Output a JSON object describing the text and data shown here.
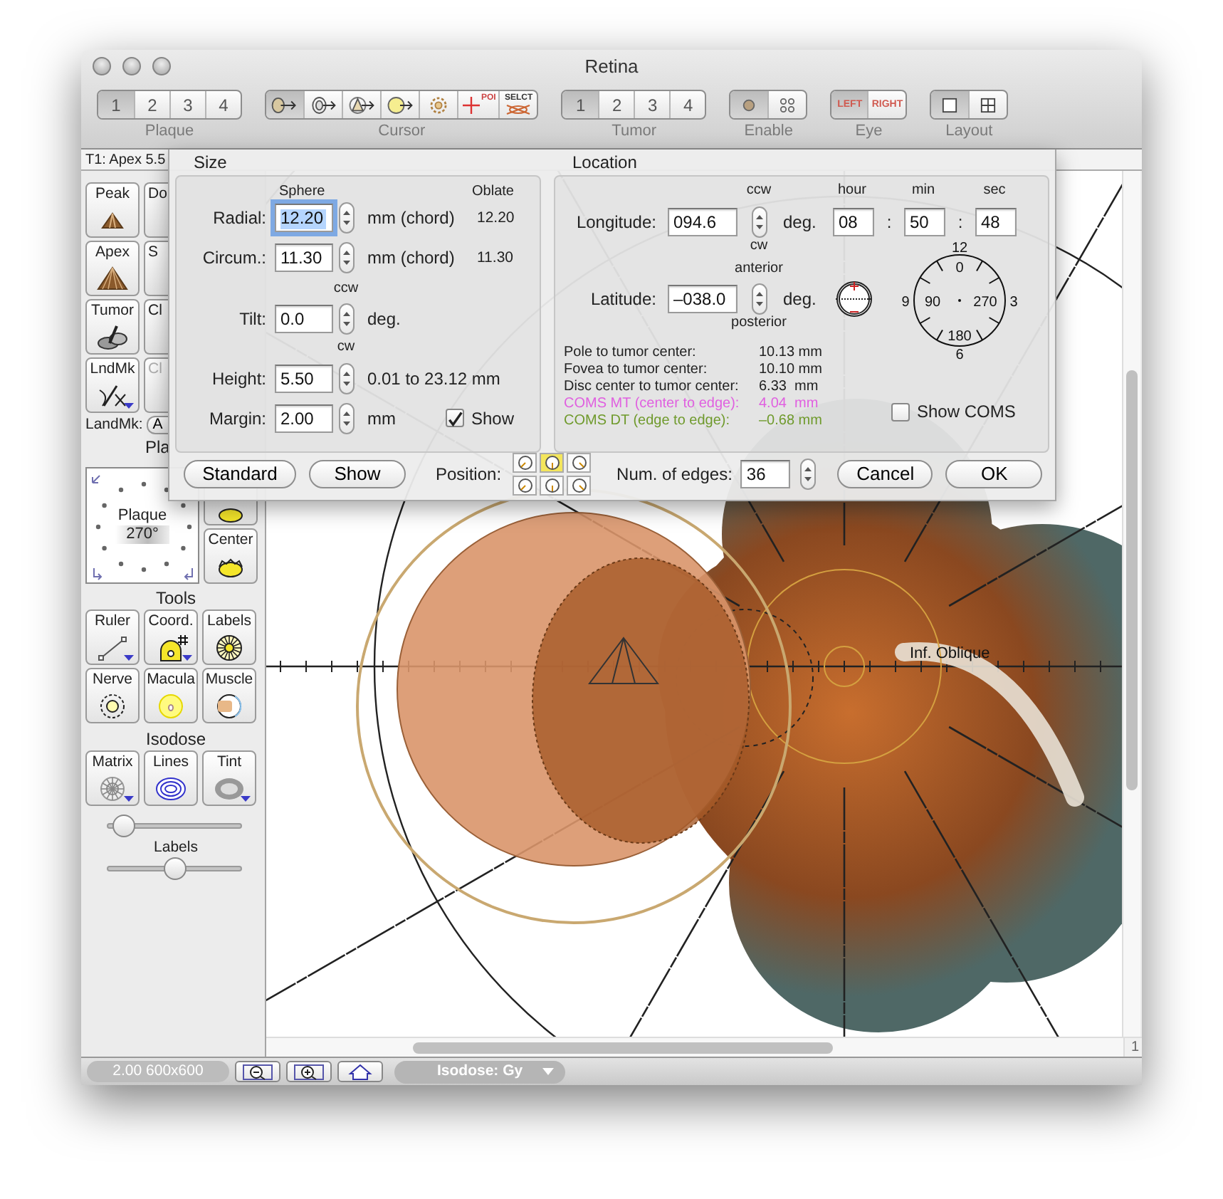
{
  "window": {
    "title": "Retina"
  },
  "toolbar": [
    {
      "label": "Plaque",
      "items": [
        {
          "kind": "number",
          "text": "1",
          "selected": true
        },
        {
          "kind": "number",
          "text": "2",
          "selected": false
        },
        {
          "kind": "number",
          "text": "3",
          "selected": false
        },
        {
          "kind": "number",
          "text": "4",
          "selected": false
        }
      ]
    },
    {
      "label": "Cursor",
      "items": [
        {
          "kind": "oval-arrow",
          "selected": true
        },
        {
          "kind": "ring-arrow",
          "selected": false
        },
        {
          "kind": "triangle-arrow",
          "selected": false
        },
        {
          "kind": "circle-arrow",
          "selected": false
        },
        {
          "kind": "gear",
          "selected": false
        },
        {
          "kind": "poi",
          "text": "POI",
          "selected": false
        },
        {
          "kind": "select",
          "text": "SELCT",
          "selected": false
        }
      ]
    },
    {
      "label": "Tumor",
      "items": [
        {
          "kind": "number",
          "text": "1",
          "selected": true
        },
        {
          "kind": "number",
          "text": "2",
          "selected": false
        },
        {
          "kind": "number",
          "text": "3",
          "selected": false
        },
        {
          "kind": "number",
          "text": "4",
          "selected": false
        }
      ]
    },
    {
      "label": "Enable",
      "items": [
        {
          "kind": "dot",
          "selected": true
        },
        {
          "kind": "dots",
          "selected": false
        }
      ]
    },
    {
      "label": "Eye",
      "items": [
        {
          "kind": "eye",
          "text": "LEFT",
          "selected": true
        },
        {
          "kind": "eye",
          "text": "RIGHT",
          "selected": false
        }
      ]
    },
    {
      "label": "Layout",
      "items": [
        {
          "kind": "single",
          "selected": true
        },
        {
          "kind": "grid",
          "selected": false
        }
      ]
    }
  ],
  "info_strip": "T1: Apex 5.5",
  "sidebar": {
    "shape_buttons": [
      {
        "label": "Peak",
        "kind": "peak",
        "disabled": false,
        "has_menu": false
      },
      {
        "label": "Do",
        "kind": "stub",
        "disabled": false,
        "has_menu": false
      },
      {
        "label": "Apex",
        "kind": "apex",
        "disabled": false,
        "has_menu": false
      },
      {
        "label": "S",
        "kind": "stub",
        "disabled": false,
        "has_menu": false
      },
      {
        "label": "Tumor",
        "kind": "tumor",
        "disabled": false,
        "has_menu": false
      },
      {
        "label": "Cl",
        "kind": "stub",
        "disabled": false,
        "has_menu": false
      },
      {
        "label": "LndMk",
        "kind": "landmark",
        "disabled": false,
        "has_menu": true
      },
      {
        "label": "Cl",
        "kind": "stub",
        "disabled": true,
        "has_menu": false
      }
    ],
    "landmark": {
      "label": "LandMk:",
      "value": "A"
    },
    "plaque_heading": "Pla",
    "rotation": {
      "title": "Plaque",
      "angle": "270°"
    },
    "center_button": "Center",
    "tools_heading": "Tools",
    "tools": [
      {
        "label": "Ruler",
        "kind": "ruler",
        "has_menu": true
      },
      {
        "label": "Coord.",
        "kind": "coord",
        "has_menu": true
      },
      {
        "label": "Labels",
        "kind": "labels",
        "has_menu": false
      },
      {
        "label": "Nerve",
        "kind": "nerve",
        "has_menu": false
      },
      {
        "label": "Macula",
        "kind": "macula",
        "has_menu": false
      },
      {
        "label": "Muscle",
        "kind": "muscle",
        "has_menu": false
      }
    ],
    "isodose_heading": "Isodose",
    "isodose_tools": [
      {
        "label": "Matrix",
        "kind": "matrix",
        "has_menu": true
      },
      {
        "label": "Lines",
        "kind": "lines",
        "has_menu": false
      },
      {
        "label": "Tint",
        "kind": "tint",
        "has_menu": true
      }
    ],
    "sliders": [
      {
        "level": 0.05
      },
      {
        "label": "Labels",
        "level": 0.5
      }
    ]
  },
  "canvas": {
    "labels": [
      "Inf. Oblique"
    ]
  },
  "scroll_corner": "1",
  "status_bar": {
    "scale": "2.00 600x600",
    "buttons": [
      {
        "kind": "zoom-out"
      },
      {
        "kind": "zoom-in"
      },
      {
        "kind": "home"
      }
    ],
    "isodose": "Isodose: Gy"
  },
  "dialog": {
    "size": {
      "title": "Size",
      "sphere_heading": "Sphere",
      "oblate_heading": "Oblate",
      "rows": [
        {
          "kind": "field",
          "label": "Radial:",
          "value": "12.20",
          "unit": "mm (chord)",
          "oblate": "12.20",
          "focused": true
        },
        {
          "kind": "field",
          "label": "Circum.:",
          "value": "11.30",
          "unit": "mm (chord)",
          "oblate": "11.30",
          "focused": false
        },
        {
          "kind": "note",
          "text": "ccw"
        },
        {
          "kind": "field",
          "label": "Tilt:",
          "value": "0.0",
          "unit": "deg.",
          "focused": false
        },
        {
          "kind": "note",
          "text": "cw"
        },
        {
          "kind": "field",
          "label": "Height:",
          "value": "5.50",
          "unit": "0.01 to 23.12 mm",
          "focused": false
        },
        {
          "kind": "field",
          "label": "Margin:",
          "value": "2.00",
          "unit": "mm",
          "focused": false,
          "checkbox": {
            "label": "Show",
            "checked": true
          }
        }
      ]
    },
    "location": {
      "title": "Location",
      "headings": {
        "ccw": "ccw",
        "hour": "hour",
        "min": "min",
        "sec": "sec"
      },
      "longitude": {
        "label": "Longitude:",
        "value": "094.6",
        "unit": "deg.",
        "hour": "08",
        "min": "50",
        "sec": "48",
        "separators": [
          ":",
          ":"
        ]
      },
      "cw": "cw",
      "anterior": "anterior",
      "latitude": {
        "label": "Latitude:",
        "value": "–038.0",
        "unit": "deg."
      },
      "posterior": "posterior",
      "dial": {
        "outer": [
          "12",
          "3",
          "6",
          "9"
        ],
        "inner": [
          "0",
          "270",
          "180",
          "90"
        ]
      },
      "stats": [
        {
          "label": "Pole to tumor center:",
          "value": "10.13 mm",
          "color": "#222222"
        },
        {
          "label": "Fovea to tumor center:",
          "value": "10.10 mm",
          "color": "#222222"
        },
        {
          "label": "Disc center to tumor center:",
          "value": "6.33  mm",
          "color": "#222222"
        },
        {
          "label": "COMS MT (center to edge):",
          "value": "4.04  mm",
          "color": "#e060e0"
        },
        {
          "label": "COMS DT (edge to edge):",
          "value": "–0.68 mm",
          "color": "#6f9a2c"
        }
      ],
      "coms": {
        "label": "Show COMS",
        "checked": false
      }
    },
    "standard": "Standard",
    "show": "Show",
    "position": {
      "label": "Position:",
      "items": [
        {
          "selected": false
        },
        {
          "selected": true
        },
        {
          "selected": false
        },
        {
          "selected": false
        },
        {
          "selected": false
        },
        {
          "selected": false
        }
      ]
    },
    "edges": {
      "label": "Num. of edges:",
      "value": "36"
    },
    "cancel": "Cancel",
    "ok": "OK"
  }
}
